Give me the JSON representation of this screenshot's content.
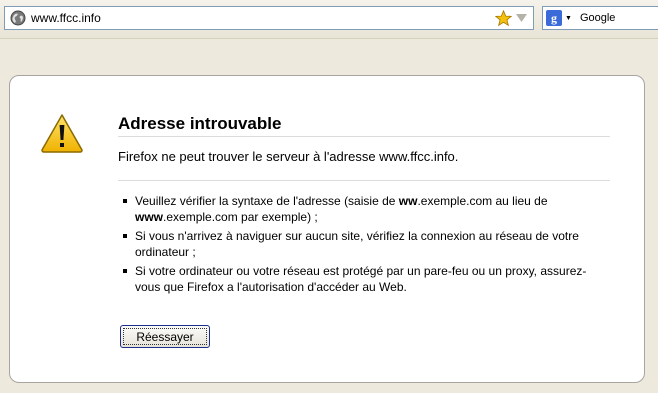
{
  "toolbar": {
    "url": "www.ffcc.info",
    "search_engine": "Google",
    "icons": {
      "site": "globe-icon",
      "bookmark": "star-icon",
      "history": "dropmarker-icon",
      "engine": "google-g-icon"
    }
  },
  "error": {
    "title": "Adresse introuvable",
    "short_desc": "Firefox ne peut trouver le serveur à l'adresse www.ffcc.info.",
    "items": [
      {
        "before": "Veuillez vérifier la syntaxe de l'adresse (saisie de ",
        "bold1": "ww",
        "middle": ".exemple.com au lieu de ",
        "bold2": "www",
        "after": ".exemple.com par exemple) ;"
      },
      {
        "text": "Si vous n'arrivez à naviguer sur aucun site, vérifiez la connexion au réseau de votre ordinateur ;"
      },
      {
        "text": "Si votre ordinateur ou votre réseau est protégé par un pare-feu ou un proxy, assurez-vous que Firefox a l'autorisation d'accéder au Web."
      }
    ],
    "retry_label": "Réessayer",
    "warning_icon": "warning-icon"
  },
  "colors": {
    "page_background": "#ede9dc",
    "box_border": "#a8a4a0",
    "warning_yellow": "#f5c10e",
    "field_border": "#7f9db9"
  }
}
